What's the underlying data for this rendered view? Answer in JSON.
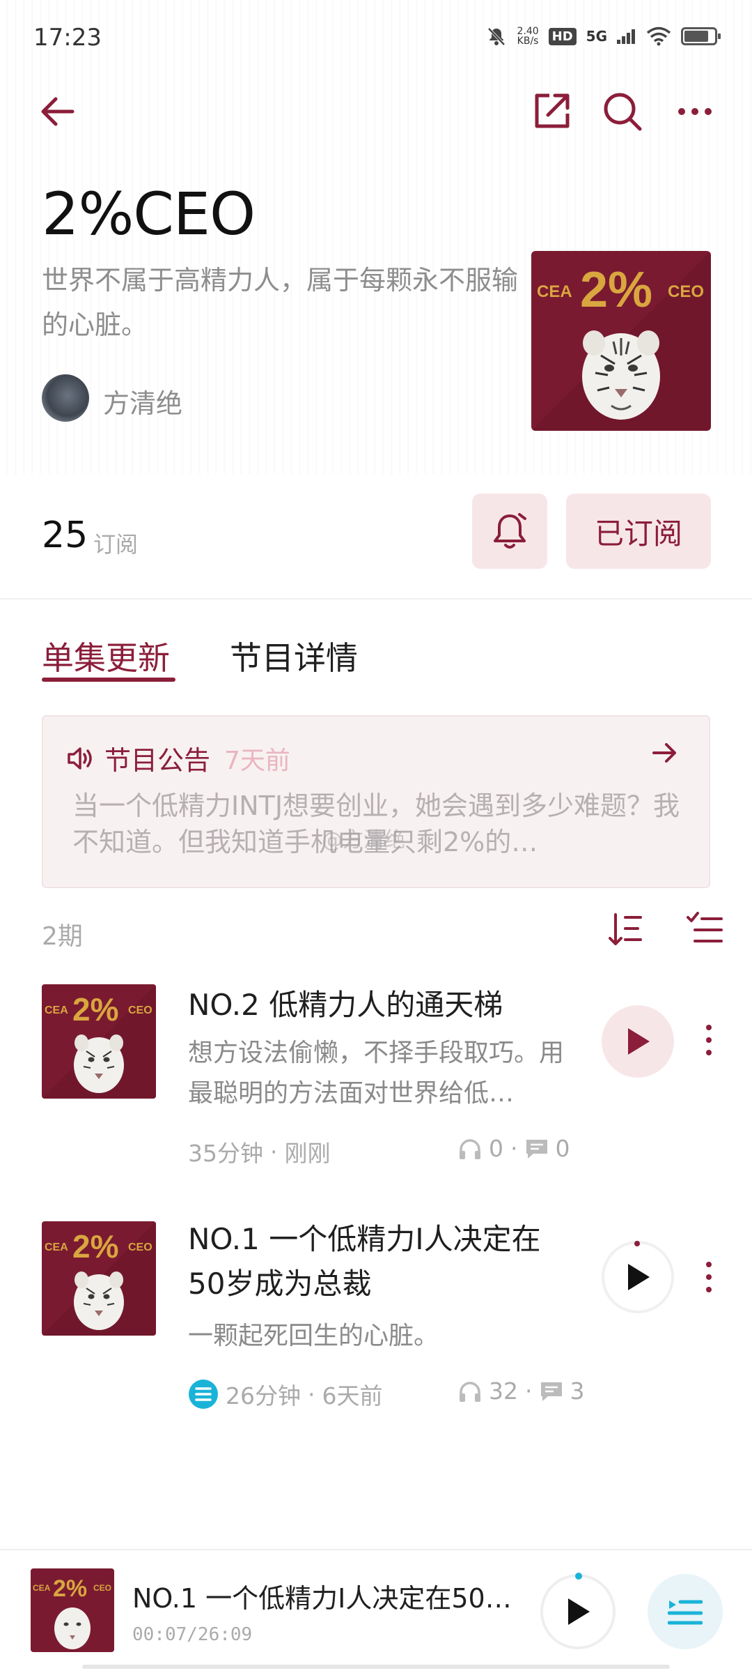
{
  "status_bar": {
    "time": "17:23",
    "net_speed_value": "2.40",
    "net_speed_unit": "KB/s",
    "hd": "HD",
    "network": "5G"
  },
  "header": {
    "back_icon": "arrow-left-icon",
    "share_icon": "share-icon",
    "search_icon": "search-icon",
    "more_icon": "more-horizontal-icon"
  },
  "podcast": {
    "title": "2%CEO",
    "description": "世界不属于高精力人，属于每颗永不服输的心脏。",
    "author": "方清绝",
    "cover_left": "CEA",
    "cover_mid": "2%",
    "cover_right": "CEO"
  },
  "subscription": {
    "count": "25",
    "count_label": "订阅",
    "subscribed_label": "已订阅"
  },
  "tabs": [
    {
      "label": "单集更新",
      "active": true
    },
    {
      "label": "节目详情",
      "active": false
    }
  ],
  "notice": {
    "title": "节目公告",
    "time": "7天前",
    "text": "当一个低精力INTJ想要创业，她会遇到多少难题？我不知道。但我知道手机电量只剩2%的…",
    "watermark": "@方清绝"
  },
  "episodes_count": "2期",
  "episodes": [
    {
      "title": "NO.2 低精力人的通天梯",
      "desc": "想方设法偷懒，不择手段取巧。用最聪明的方法面对世界给低…",
      "duration": "35分钟",
      "time": "刚刚",
      "plays": "0",
      "comments": "0"
    },
    {
      "title": "NO.1 一个低精力I人决定在50岁成为总裁",
      "desc": "一颗起死回生的心脏。",
      "duration": "26分钟",
      "time": "6天前",
      "plays": "32",
      "comments": "3"
    }
  ],
  "mini_player": {
    "title": "NO.1 一个低精力I人决定在50…",
    "time": "00:07/26:09",
    "progress": 0.0045
  },
  "colors": {
    "accent": "#8b1e3a",
    "accent_bg": "#f7e6e8",
    "cover_bg": "#7a1a30",
    "gold": "#d9a640",
    "blue": "#1ab3d8"
  },
  "separator": "·"
}
